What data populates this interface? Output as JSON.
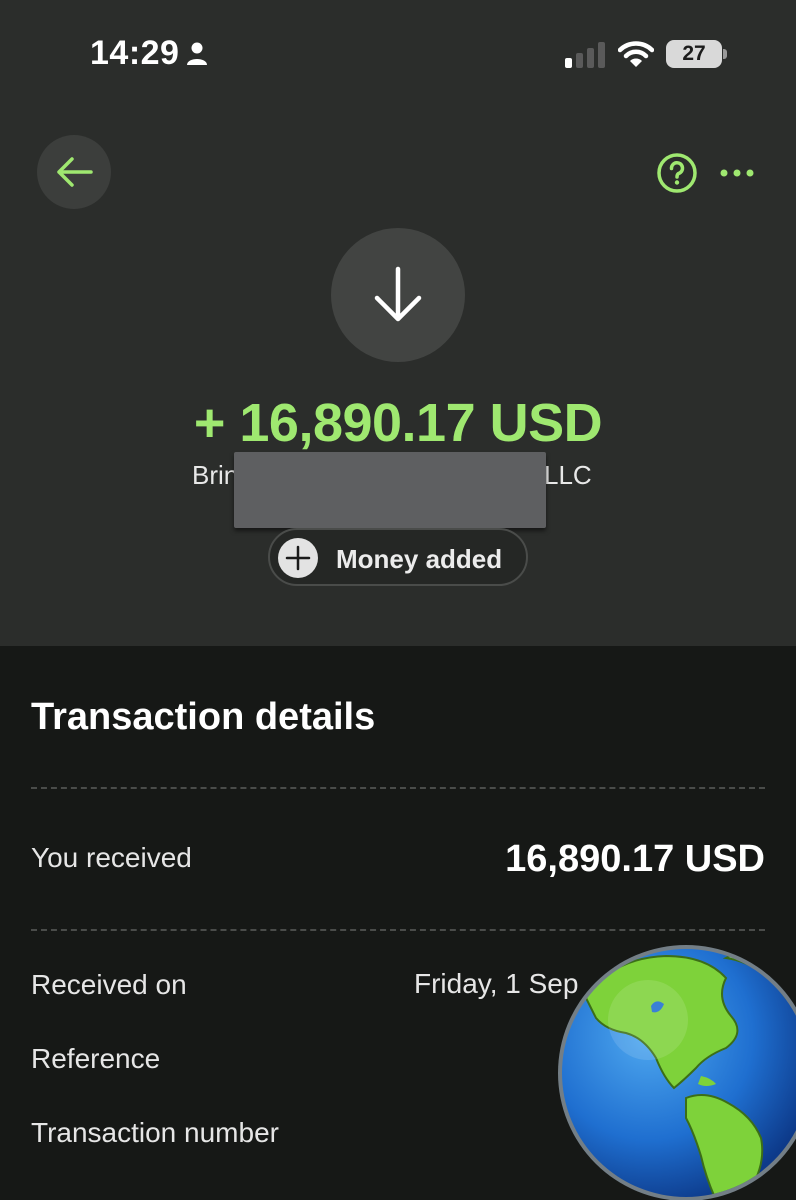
{
  "status_bar": {
    "time": "14:29",
    "battery": "27",
    "icons": [
      "person-icon",
      "signal-icon",
      "wifi-icon",
      "battery-icon"
    ]
  },
  "header": {
    "icons": [
      "arrow-left-icon",
      "question-circle-icon",
      "more-dots-icon"
    ]
  },
  "transaction": {
    "direction_icon": "arrow-down-icon",
    "amount": "+ 16,890.17 USD",
    "sender_visible_start": "Brin",
    "sender_visible_end": "LLC",
    "type_label": "Money added",
    "type_icon": "plus-icon"
  },
  "details": {
    "title": "Transaction details",
    "rows": [
      {
        "label": "You received",
        "value": "16,890.17 USD"
      },
      {
        "label": "Received on",
        "value": "Friday, 1 Sep"
      },
      {
        "label": "Reference",
        "value": ""
      },
      {
        "label": "Transaction number",
        "value": ""
      }
    ]
  },
  "colors": {
    "accent": "#9fe870",
    "top_background": "#2b2d2b",
    "bottom_background": "#161816"
  }
}
